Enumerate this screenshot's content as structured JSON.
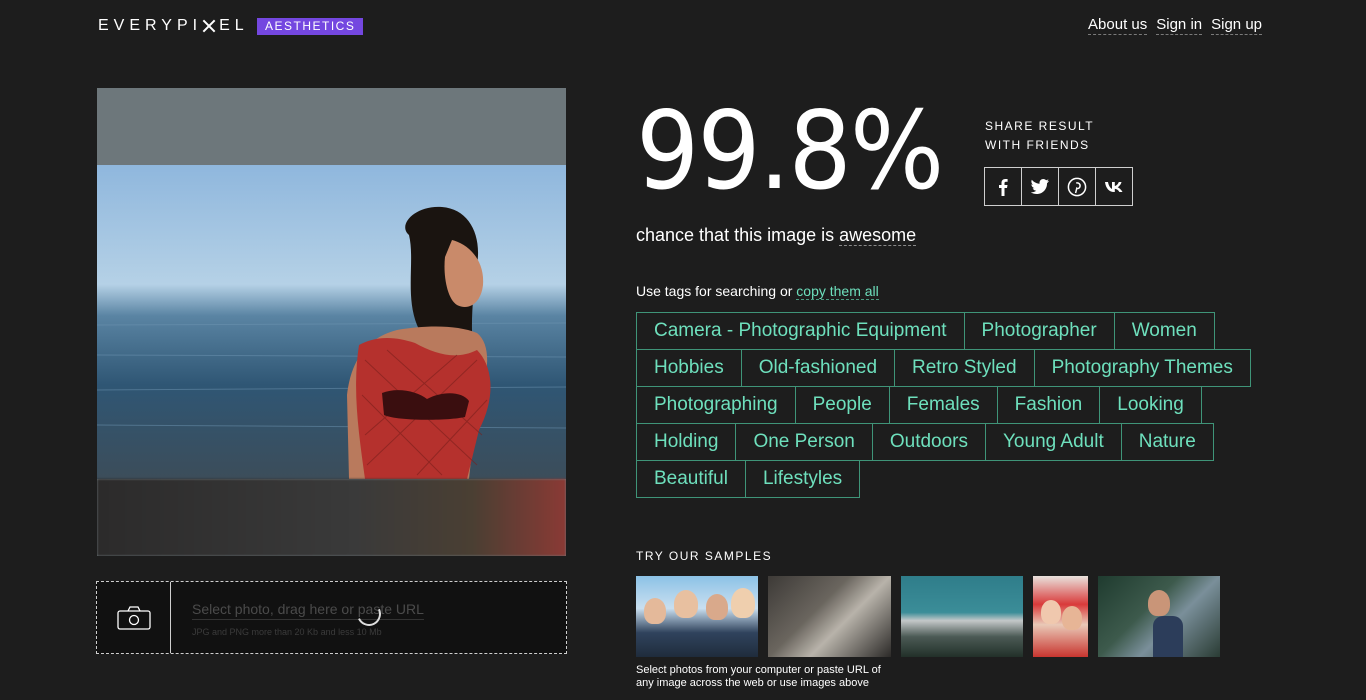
{
  "header": {
    "logo_left": "EVERYPI",
    "logo_right": "EL",
    "badge": "AESTHETICS",
    "nav": [
      "About us",
      "Sign in",
      "Sign up"
    ]
  },
  "upload": {
    "hint": "Select photo, drag here or paste URL",
    "sub": "JPG and PNG more than 20 Kb and less 10 Mb"
  },
  "result": {
    "score": "99.8%",
    "share_line1": "SHARE RESULT",
    "share_line2": "WITH FRIENDS",
    "share_buttons": [
      "f",
      "t",
      "p",
      "vk"
    ],
    "chance_prefix": "chance that this image is",
    "chance_word": "awesome"
  },
  "tags": {
    "intro": "Use tags for searching or",
    "copy_link": "copy them all",
    "items": [
      "Camera - Photographic Equipment",
      "Photographer",
      "Women",
      "Hobbies",
      "Old-fashioned",
      "Retro Styled",
      "Photography Themes",
      "Photographing",
      "People",
      "Females",
      "Fashion",
      "Looking",
      "Holding",
      "One Person",
      "Outdoors",
      "Young Adult",
      "Nature",
      "Beautiful",
      "Lifestyles"
    ]
  },
  "samples": {
    "label": "TRY OUR SAMPLES",
    "note": "Select photos from your computer or paste URL of any image across the web or use images above"
  },
  "colors": {
    "background": "#1d1d1d",
    "badge": "#7447e0",
    "tag_text": "#6ee0bd",
    "tag_border": "#3f9478"
  }
}
